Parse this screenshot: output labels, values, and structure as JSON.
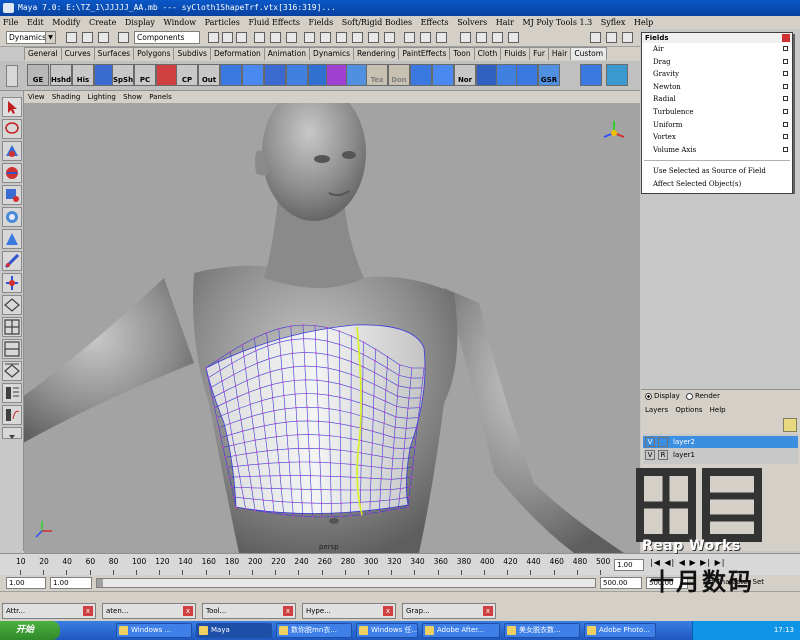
{
  "window": {
    "title": "Maya 7.0: E:\\TZ_1\\JJJJJ_AA.mb   ---   syCloth1ShapeTrf.vtx[316:319]..."
  },
  "menubar": {
    "items": [
      "File",
      "Edit",
      "Modify",
      "Create",
      "Display",
      "Window",
      "Particles",
      "Fluid Effects",
      "Fields",
      "Soft/Rigid Bodies",
      "Effects",
      "Solvers",
      "Hair",
      "MJ Poly Tools 1.3",
      "Syflex",
      "Help"
    ]
  },
  "statusline": {
    "menu_set": "Dynamics",
    "selection_mode": "Components"
  },
  "shelf": {
    "tabs": [
      "General",
      "Curves",
      "Surfaces",
      "Polygons",
      "Subdivs",
      "Deformation",
      "Animation",
      "Dynamics",
      "Rendering",
      "PaintEffects",
      "Toon",
      "Cloth",
      "Fluids",
      "Fur",
      "Hair",
      "Custom"
    ],
    "active_tab": "Custom",
    "buttons": [
      "GE",
      "Hshd",
      "His",
      "",
      "SpSh",
      "PC",
      "",
      "CP",
      "Out",
      "",
      "",
      "",
      "",
      "",
      "",
      "",
      "Tex",
      "Don",
      "",
      "",
      "Nor",
      "",
      "",
      "",
      "GSR",
      "",
      ""
    ]
  },
  "viewport": {
    "menu": [
      "View",
      "Shading",
      "Lighting",
      "Show",
      "Panels"
    ],
    "camera_label": "persp"
  },
  "fields_menu": {
    "title": "Fields",
    "items": [
      "Air",
      "Drag",
      "Gravity",
      "Newton",
      "Radial",
      "Turbulence",
      "Uniform",
      "Vortex",
      "Volume Axis"
    ],
    "extra_items": [
      "Use Selected as Source of Field",
      "Affect Selected Object(s)"
    ]
  },
  "layer_editor": {
    "display_label": "Display",
    "render_label": "Render",
    "menu": [
      "Layers",
      "Options",
      "Help"
    ],
    "layers": [
      {
        "visible": "V",
        "ref": "",
        "name": "layer2",
        "selected": true
      },
      {
        "visible": "V",
        "ref": "R",
        "name": "layer1",
        "selected": false
      }
    ]
  },
  "time_slider": {
    "ticks": [
      "10",
      "20",
      "40",
      "60",
      "80",
      "100",
      "120",
      "140",
      "160",
      "180",
      "200",
      "220",
      "240",
      "260",
      "280",
      "300",
      "320",
      "340",
      "360",
      "380",
      "400",
      "420",
      "440",
      "460",
      "480",
      "500"
    ],
    "current_frame": "1.00"
  },
  "range_slider": {
    "start_time": "1.00",
    "range_start": "1.00",
    "range_end": "500.00",
    "end_time": "500.00",
    "character_label": "No Character Set"
  },
  "open_windows": [
    {
      "label": "Attr..."
    },
    {
      "label": "aten..."
    },
    {
      "label": "Tool..."
    },
    {
      "label": "Hype..."
    },
    {
      "label": "Grap..."
    }
  ],
  "taskbar": {
    "start_label": "开始",
    "tasks": [
      {
        "label": "Windows ..."
      },
      {
        "label": "Maya"
      },
      {
        "label": "数你脱mn衣..."
      },
      {
        "label": "Windows 任..."
      },
      {
        "label": "Adobe After..."
      },
      {
        "label": "美女脱衣数..."
      },
      {
        "label": "Adobe Photo..."
      }
    ],
    "clock": "17:13"
  },
  "watermark": {
    "line1": "Reap Works",
    "line2": "十月数码"
  },
  "colors": {
    "titlebar": "#0a58c8",
    "viewport_bg": "#a3a3a3",
    "layer_selected": "#3c8ee0",
    "mesh_line": "#3a3ad8",
    "vertex": "#d040d0",
    "seam": "#d8f020"
  }
}
